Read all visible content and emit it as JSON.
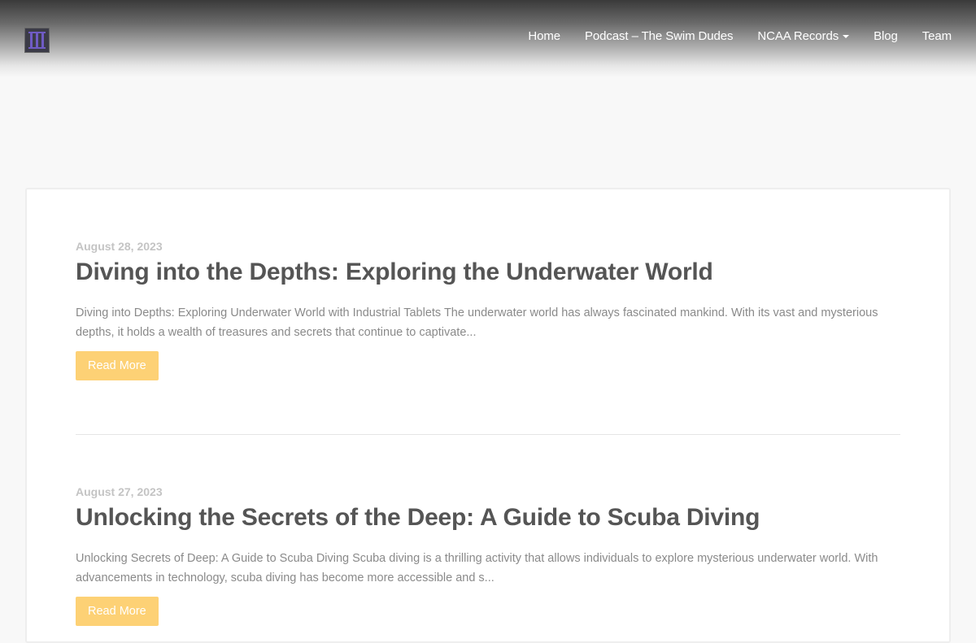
{
  "header": {
    "nav": [
      {
        "label": "Home"
      },
      {
        "label": "Podcast – The Swim Dudes"
      },
      {
        "label": "NCAA Records",
        "has_dropdown": true
      },
      {
        "label": "Blog"
      },
      {
        "label": "Team"
      }
    ]
  },
  "posts": [
    {
      "date": "August 28, 2023",
      "title": "Diving into the Depths: Exploring the Underwater World",
      "excerpt": "Diving into Depths: Exploring Underwater World with Industrial Tablets The underwater world has always fascinated mankind. With its vast and mysterious depths, it holds a wealth of treasures and secrets that continue to captivate...",
      "button": "Read More"
    },
    {
      "date": "August 27, 2023",
      "title": "Unlocking the Secrets of the Deep: A Guide to Scuba Diving",
      "excerpt": "Unlocking Secrets of Deep: A Guide to Scuba Diving Scuba diving is a thrilling activity that allows individuals to explore mysterious underwater world. With advancements in technology, scuba diving has become more accessible and s...",
      "button": "Read More"
    }
  ],
  "colors": {
    "accent_button": "#fdd175",
    "title_text": "#555555",
    "date_text": "#c4c4c4",
    "excerpt_text": "#8a8a8a",
    "logo_purple": "#6f5bc4"
  }
}
